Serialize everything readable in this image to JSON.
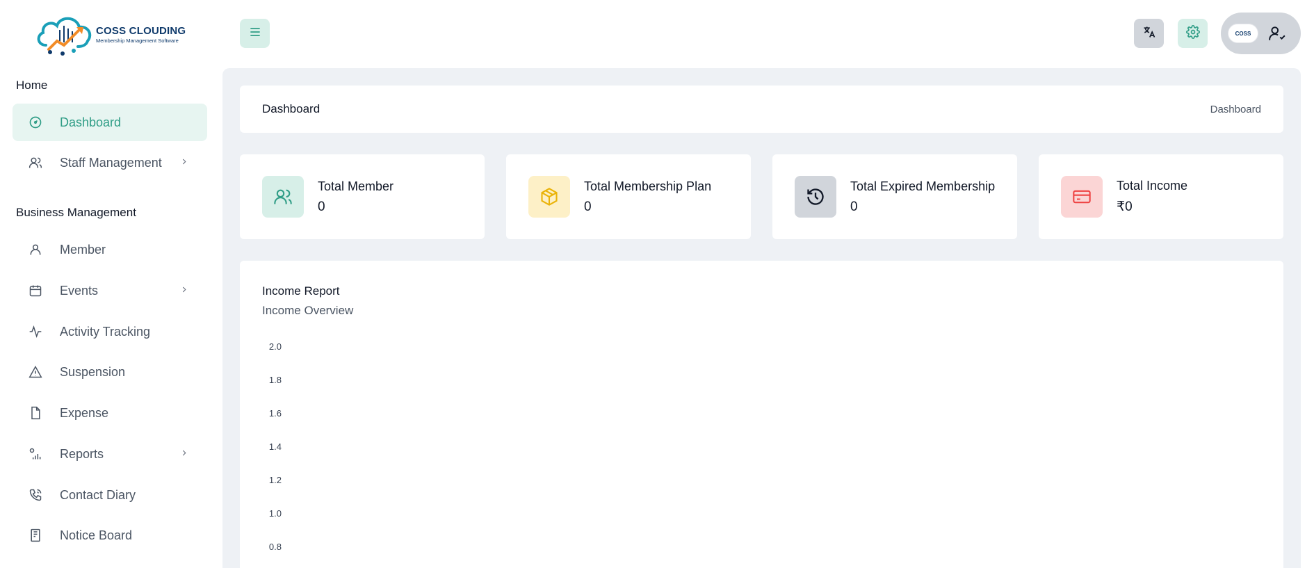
{
  "brand": {
    "title": "COSS CLOUDING",
    "subtitle": "Membership Management Software",
    "avatar_text": "COSS"
  },
  "sidebar": {
    "section_home": "Home",
    "section_business": "Business Management",
    "items": [
      {
        "label": "Dashboard",
        "icon": "dashboard-icon",
        "active": true,
        "chevron": false
      },
      {
        "label": "Staff Management",
        "icon": "users-icon",
        "active": false,
        "chevron": true
      },
      {
        "label": "Member",
        "icon": "user-icon",
        "active": false,
        "chevron": false
      },
      {
        "label": "Events",
        "icon": "calendar-icon",
        "active": false,
        "chevron": true
      },
      {
        "label": "Activity Tracking",
        "icon": "activity-icon",
        "active": false,
        "chevron": false
      },
      {
        "label": "Suspension",
        "icon": "warning-icon",
        "active": false,
        "chevron": false
      },
      {
        "label": "Expense",
        "icon": "file-icon",
        "active": false,
        "chevron": false
      },
      {
        "label": "Reports",
        "icon": "reports-icon",
        "active": false,
        "chevron": true
      },
      {
        "label": "Contact Diary",
        "icon": "phone-icon",
        "active": false,
        "chevron": false
      },
      {
        "label": "Notice Board",
        "icon": "notice-icon",
        "active": false,
        "chevron": false
      }
    ]
  },
  "header": {
    "menu_icon": "hamburger-icon",
    "translate_icon": "translate-icon",
    "settings_icon": "gear-icon",
    "profile_icon": "user-check-icon"
  },
  "page": {
    "title": "Dashboard",
    "breadcrumb": "Dashboard"
  },
  "stats": [
    {
      "label": "Total Member",
      "value": "0",
      "icon": "users-icon",
      "bg": "#d7efe8",
      "fg": "#2f9d86"
    },
    {
      "label": "Total Membership Plan",
      "value": "0",
      "icon": "package-icon",
      "bg": "#fdf0c7",
      "fg": "#eab308"
    },
    {
      "label": "Total Expired Membership",
      "value": "0",
      "icon": "history-icon",
      "bg": "#d1d5db",
      "fg": "#111827"
    },
    {
      "label": "Total Income",
      "value": "₹0",
      "icon": "credit-card-icon",
      "bg": "#fbd5d5",
      "fg": "#ef4444"
    }
  ],
  "income_report": {
    "title": "Income Report",
    "subtitle": "Income Overview"
  },
  "chart_data": {
    "type": "line",
    "title": "",
    "xlabel": "",
    "ylabel": "",
    "y_ticks": [
      "2.0",
      "1.8",
      "1.6",
      "1.4",
      "1.2",
      "1.0",
      "0.8"
    ],
    "ylim": [
      0.8,
      2.0
    ],
    "series": []
  },
  "colors": {
    "accent": "#2f9d86",
    "main_bg": "#eef1f5",
    "active_bg": "#e7f5f1"
  }
}
